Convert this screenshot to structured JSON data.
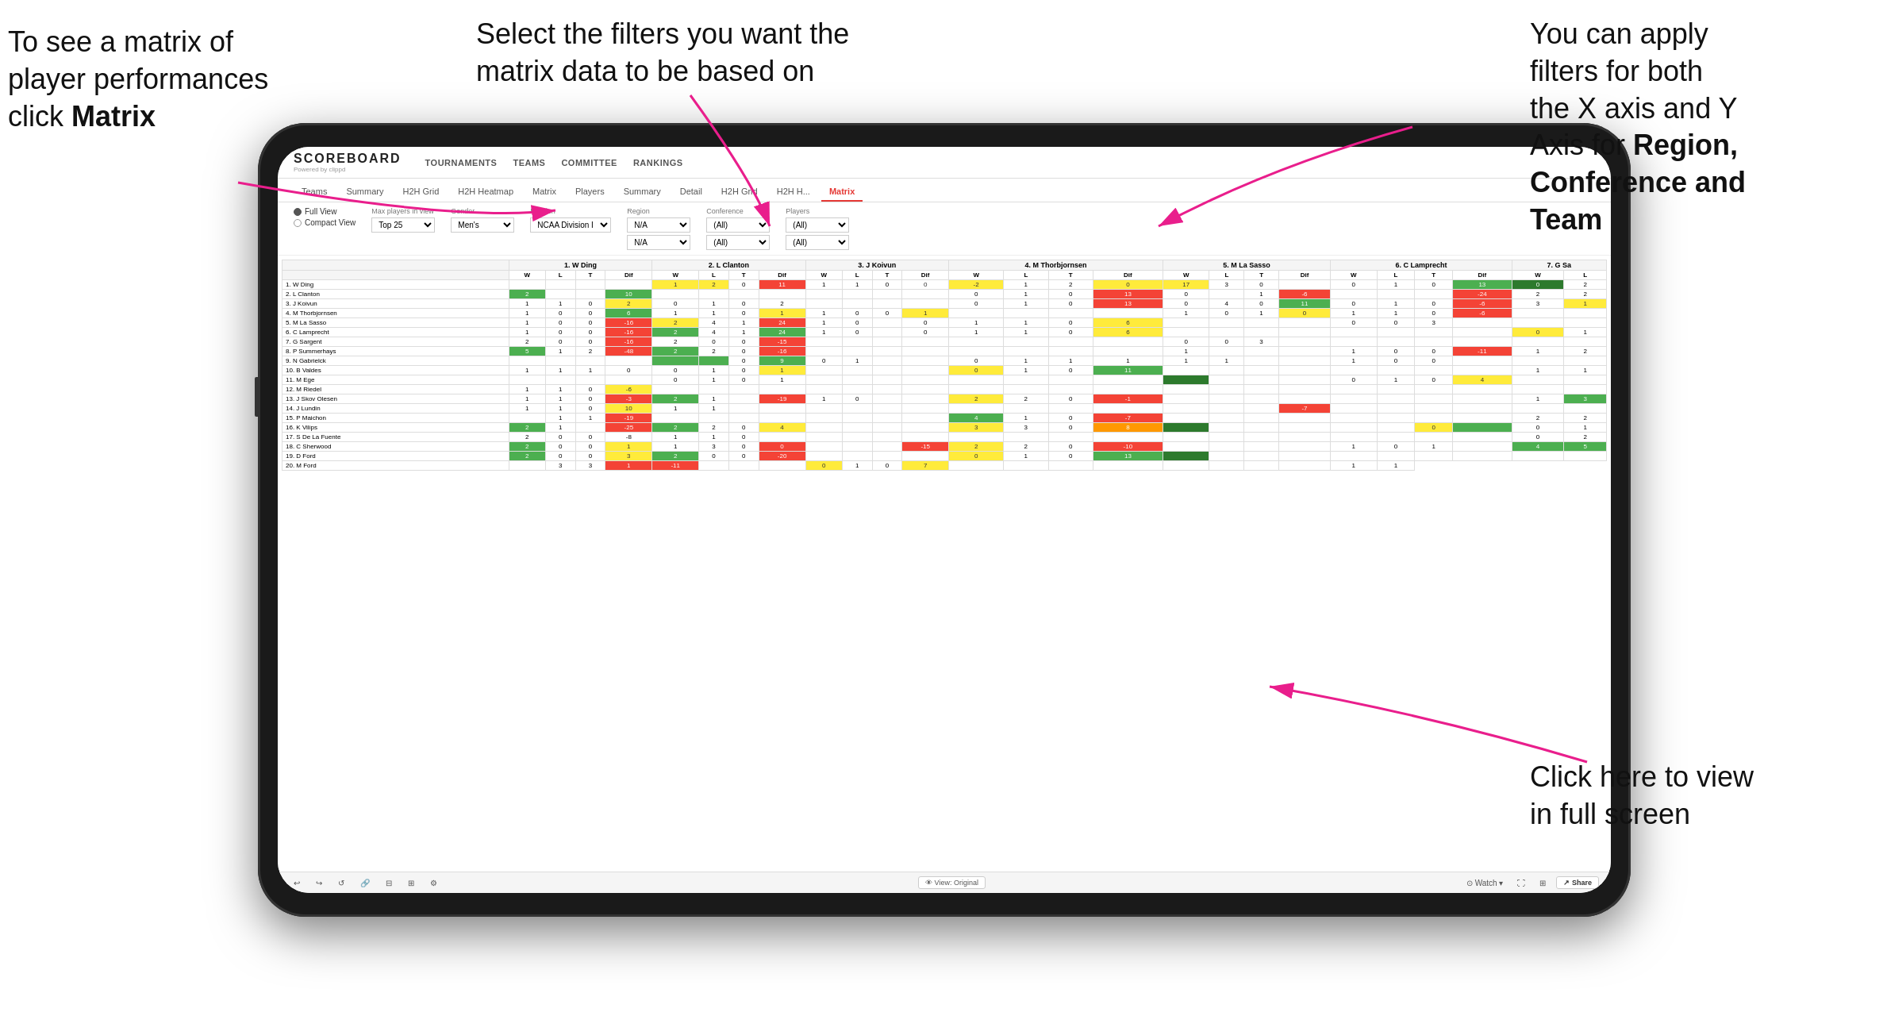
{
  "annotations": {
    "top_left": {
      "line1": "To see a matrix of",
      "line2": "player performances",
      "line3_plain": "click ",
      "line3_bold": "Matrix"
    },
    "top_center": {
      "text": "Select the filters you want the matrix data to be based on"
    },
    "top_right": {
      "line1": "You  can apply",
      "line2": "filters for both",
      "line3": "the X axis and Y",
      "line4_plain": "Axis for ",
      "line4_bold": "Region,",
      "line5_bold": "Conference and",
      "line6_bold": "Team"
    },
    "bottom_right": {
      "line1": "Click here to view",
      "line2": "in full screen"
    }
  },
  "app": {
    "logo": "SCOREBOARD",
    "logo_sub": "Powered by clippd",
    "nav_items": [
      "TOURNAMENTS",
      "TEAMS",
      "COMMITTEE",
      "RANKINGS"
    ],
    "sub_tabs": [
      "Teams",
      "Summary",
      "H2H Grid",
      "H2H Heatmap",
      "Matrix",
      "Players",
      "Summary",
      "Detail",
      "H2H Grid",
      "H2H H...",
      "Matrix"
    ],
    "active_sub_tab": "Matrix"
  },
  "filters": {
    "view_options": [
      "Full View",
      "Compact View"
    ],
    "selected_view": "Full View",
    "max_players": {
      "label": "Max players in view",
      "value": "Top 25"
    },
    "gender": {
      "label": "Gender",
      "value": "Men's"
    },
    "division": {
      "label": "Division",
      "value": "NCAA Division I"
    },
    "region": {
      "label": "Region",
      "values": [
        "N/A",
        "N/A"
      ]
    },
    "conference": {
      "label": "Conference",
      "values": [
        "(All)",
        "(All)"
      ]
    },
    "players": {
      "label": "Players",
      "values": [
        "(All)",
        "(All)"
      ]
    }
  },
  "matrix": {
    "col_headers": [
      "1. W Ding",
      "2. L Clanton",
      "3. J Koivun",
      "4. M Thorbjornsen",
      "5. M La Sasso",
      "6. C Lamprecht",
      "7. G Sa"
    ],
    "sub_headers": [
      "W",
      "L",
      "T",
      "Dif"
    ],
    "rows": [
      {
        "name": "1. W Ding",
        "cells": "row1"
      },
      {
        "name": "2. L Clanton",
        "cells": "row2"
      },
      {
        "name": "3. J Koivun",
        "cells": "row3"
      },
      {
        "name": "4. M Thorbjornsen",
        "cells": "row4"
      },
      {
        "name": "5. M La Sasso",
        "cells": "row5"
      },
      {
        "name": "6. C Lamprecht",
        "cells": "row6"
      },
      {
        "name": "7. G Sargent",
        "cells": "row7"
      },
      {
        "name": "8. P Summerhays",
        "cells": "row8"
      },
      {
        "name": "9. N Gabrielck",
        "cells": "row9"
      },
      {
        "name": "10. B Valdes",
        "cells": "row10"
      },
      {
        "name": "11. M Ege",
        "cells": "row11"
      },
      {
        "name": "12. M Riedel",
        "cells": "row12"
      },
      {
        "name": "13. J Skov Olesen",
        "cells": "row13"
      },
      {
        "name": "14. J Lundin",
        "cells": "row14"
      },
      {
        "name": "15. P Maichon",
        "cells": "row15"
      },
      {
        "name": "16. K Vilips",
        "cells": "row16"
      },
      {
        "name": "17. S De La Fuente",
        "cells": "row17"
      },
      {
        "name": "18. C Sherwood",
        "cells": "row18"
      },
      {
        "name": "19. D Ford",
        "cells": "row19"
      },
      {
        "name": "20. M Ford",
        "cells": "row20"
      }
    ]
  },
  "toolbar": {
    "view_label": "View: Original",
    "watch_label": "Watch",
    "share_label": "Share"
  }
}
